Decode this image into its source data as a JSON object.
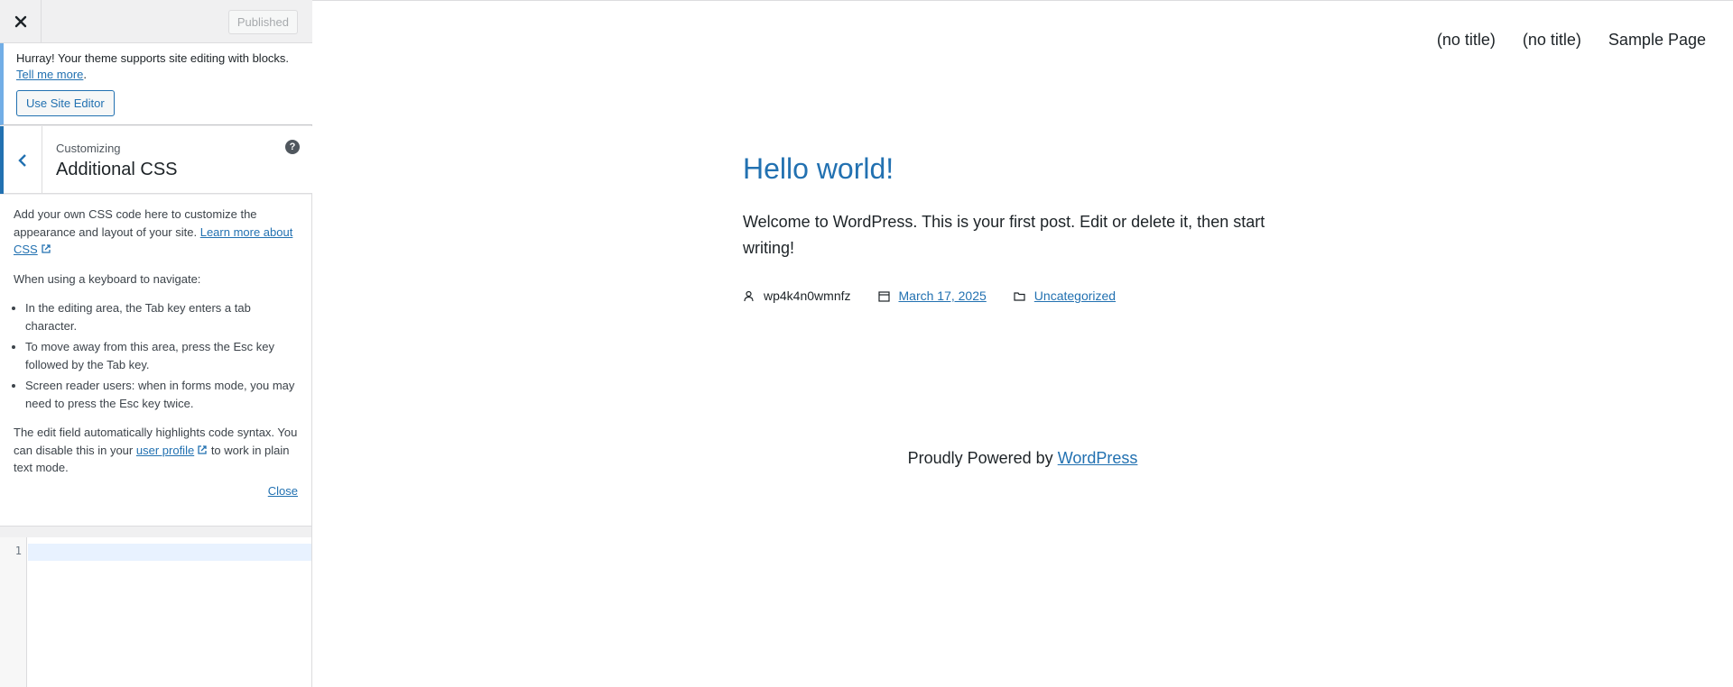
{
  "header": {
    "close_icon": "close-icon",
    "publish_label": "Published"
  },
  "notice": {
    "text": "Hurray! Your theme supports site editing with blocks.",
    "link": "Tell me more",
    "trailing": ".",
    "button_label": "Use Site Editor"
  },
  "section": {
    "back_icon": "chevron-left-icon",
    "customizing_label": "Customizing",
    "title": "Additional CSS",
    "help_icon": "?"
  },
  "description": {
    "intro": "Add your own CSS code here to customize the appearance and layout of your site.",
    "learn_more_link": "Learn more about CSS",
    "keyboard_heading": "When using a keyboard to navigate:",
    "bullets": [
      "In the editing area, the Tab key enters a tab character.",
      "To move away from this area, press the Esc key followed by the Tab key.",
      "Screen reader users: when in forms mode, you may need to press the Esc key twice."
    ],
    "syntax_text_before": "The edit field automatically highlights code syntax. You can disable this in your",
    "user_profile_link": "user profile",
    "syntax_text_after": "to work in plain text mode.",
    "close_link": "Close"
  },
  "editor": {
    "line_number": "1",
    "content": ""
  },
  "preview": {
    "nav": [
      "(no title)",
      "(no title)",
      "Sample Page"
    ],
    "post_title": "Hello world!",
    "post_excerpt": "Welcome to WordPress. This is your first post. Edit or delete it, then start writing!",
    "meta": {
      "author": "wp4k4n0wmnfz",
      "date": "March 17, 2025",
      "category": "Uncategorized"
    },
    "footer_text": "Proudly Powered by",
    "footer_link": "WordPress"
  },
  "colors": {
    "accent": "#2271b1",
    "notice_border": "#72aee6",
    "sidebar_bg": "#f0f0f1"
  }
}
